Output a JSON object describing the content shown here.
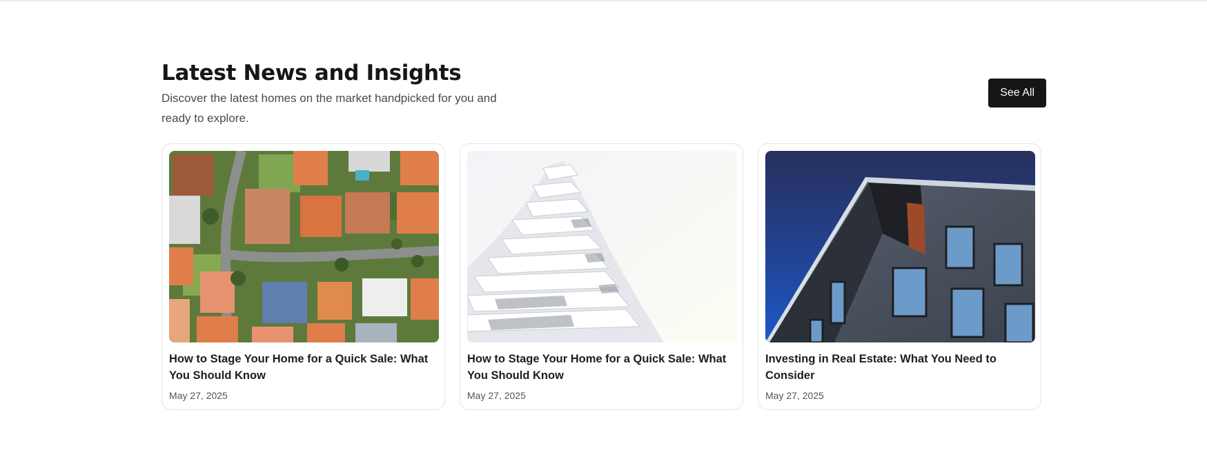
{
  "section": {
    "title": "Latest News and Insights",
    "subtitle": "Discover the latest homes on the market handpicked for you and ready to explore.",
    "see_all_label": "See All"
  },
  "cards": [
    {
      "title": "How to Stage Your Home for a Quick Sale: What You Should Know",
      "date": "May 27, 2025",
      "image": "aerial-neighborhood-photo"
    },
    {
      "title": "How to Stage Your Home for a Quick Sale: What You Should Know",
      "date": "May 27, 2025",
      "image": "white-modern-tower-photo"
    },
    {
      "title": "Investing in Real Estate: What You Need to Consider",
      "date": "May 27, 2025",
      "image": "dark-brick-building-photo"
    }
  ],
  "colors": {
    "button_bg": "#161616",
    "button_text": "#ffffff",
    "card_border": "#e4e4e4"
  }
}
